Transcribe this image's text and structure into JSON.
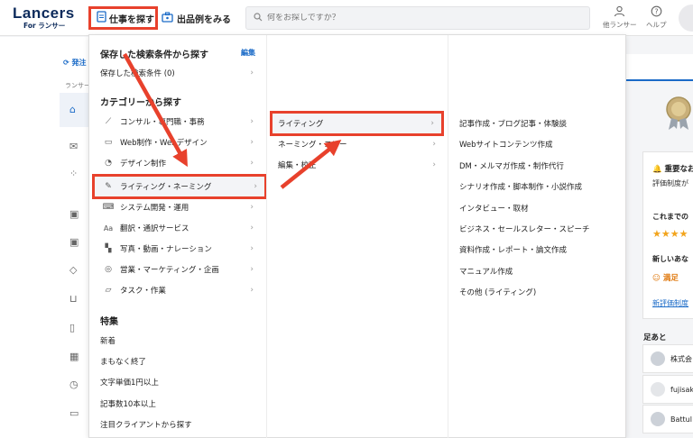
{
  "header": {
    "logo": "Lancers",
    "logo_sub": "For ランサー",
    "nav_find": "仕事を探す",
    "nav_samples": "出品例をみる",
    "search_placeholder": "何をお探しですか？",
    "icon_account_label": "他ランサー",
    "icon_help_label": "ヘルプ"
  },
  "sidebar": {
    "top_link": "発注",
    "breadcrumb": "ランサー"
  },
  "dropdown": {
    "saved_title": "保存した検索条件から探す",
    "edit_label": "編集",
    "saved_item": "保存した検索条件 (0)",
    "category_title": "カテゴリーから探す",
    "categories": [
      {
        "label": "コンサル・専門職・事務",
        "icon": "chart-icon"
      },
      {
        "label": "Web制作・Webデザイン",
        "icon": "monitor-icon"
      },
      {
        "label": "デザイン制作",
        "icon": "palette-icon"
      },
      {
        "label": "ライティング・ネーミング",
        "icon": "pen-icon"
      },
      {
        "label": "システム開発・運用",
        "icon": "code-icon"
      },
      {
        "label": "翻訳・通訳サービス",
        "icon": "translate-icon"
      },
      {
        "label": "写真・動画・ナレーション",
        "icon": "media-icon"
      },
      {
        "label": "営業・マーケティング・企画",
        "icon": "target-icon"
      },
      {
        "label": "タスク・作業",
        "icon": "task-icon"
      }
    ],
    "feature_title": "特集",
    "features": [
      "新着",
      "まもなく終了",
      "文字単価1円以上",
      "記事数10本以上",
      "注目クライアントから探す"
    ],
    "subcategories": [
      "ライティング",
      "ネーミング・コピー",
      "編集・校正"
    ],
    "details": [
      "記事作成・ブログ記事・体験談",
      "Webサイトコンテンツ作成",
      "DM・メルマガ作成・制作代行",
      "シナリオ作成・脚本制作・小説作成",
      "インタビュー・取材",
      "ビジネス・セールスレター・スピーチ",
      "資料作成・レポート・論文作成",
      "マニュアル作成",
      "その他 (ライティング)"
    ]
  },
  "right_panel": {
    "notice_title": "重要なお",
    "notice_text": "評価制度が",
    "rating_title": "これまでの",
    "new_title": "新しいあな",
    "satisfied": "満足",
    "link": "新評価制度",
    "footprint_title": "足あと",
    "footprints": [
      "株式会",
      "fujisak",
      "Battul"
    ]
  },
  "colors": {
    "annotation": "#e8412c",
    "brand": "#0c2a5b",
    "link": "#1a6ac7"
  }
}
